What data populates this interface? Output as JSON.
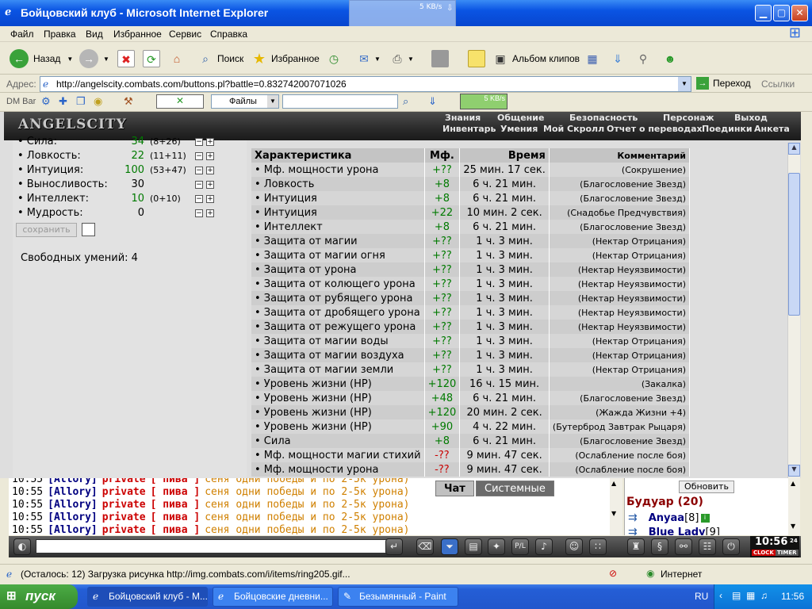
{
  "window": {
    "title": "Бойцовский клуб - Microsoft Internet Explorer"
  },
  "netmon": {
    "speed": "5 KB/s"
  },
  "menu": [
    "Файл",
    "Правка",
    "Вид",
    "Избранное",
    "Сервис",
    "Справка"
  ],
  "toolbar": {
    "back": "Назад",
    "search": "Поиск",
    "favorites": "Избранное",
    "album": "Альбом клипов"
  },
  "address": {
    "label": "Адрес:",
    "url": "http://angelscity.combats.com/buttons.pl?battle=0.832742007071026",
    "go": "Переход",
    "links": "Ссылки"
  },
  "dmbar": {
    "label": "DM Bar",
    "files": "Файлы",
    "speed": "5 KB/s"
  },
  "game": {
    "logo": "ANGELSCITY",
    "nav_top": [
      "Знания",
      "Общение",
      "Безопасность",
      "Персонаж",
      "Выход"
    ],
    "nav_bottom": [
      "Инвентарь",
      "Умения",
      "Мой Скролл",
      "Отчет о переводах",
      "Поединки",
      "Анкета"
    ]
  },
  "stats": [
    {
      "name": "• Сила:",
      "value": "34",
      "extra": "(8+26)"
    },
    {
      "name": "• Ловкость:",
      "value": "22",
      "extra": "(11+11)"
    },
    {
      "name": "• Интуиция:",
      "value": "100",
      "extra": "(53+47)"
    },
    {
      "name": "• Выносливость:",
      "value": "30",
      "extra": ""
    },
    {
      "name": "• Интеллект:",
      "value": "10",
      "extra": "(0+10)"
    },
    {
      "name": "• Мудрость:",
      "value": "0",
      "extra": ""
    }
  ],
  "save_button": "сохранить",
  "free_skills": "Свободных умений: 4",
  "table": {
    "headers": [
      "Характеристика",
      "Мф.",
      "Время",
      "Комментарий"
    ],
    "rows": [
      [
        "• Мф. мощности урона",
        "+??",
        "25 мин. 17 сек.",
        "(Сокрушение)"
      ],
      [
        "• Ловкость",
        "+8",
        "6 ч. 21 мин.",
        "(Благословение Звезд)"
      ],
      [
        "• Интуиция",
        "+8",
        "6 ч. 21 мин.",
        "(Благословение Звезд)"
      ],
      [
        "• Интуиция",
        "+22",
        "10 мин. 2 сек.",
        "(Снадобье Предчувствия)"
      ],
      [
        "• Интеллект",
        "+8",
        "6 ч. 21 мин.",
        "(Благословение Звезд)"
      ],
      [
        "• Защита от магии",
        "+??",
        "1 ч. 3 мин.",
        "(Нектар Отрицания)"
      ],
      [
        "• Защита от магии огня",
        "+??",
        "1 ч. 3 мин.",
        "(Нектар Отрицания)"
      ],
      [
        "• Защита от урона",
        "+??",
        "1 ч. 3 мин.",
        "(Нектар Неуязвимости)"
      ],
      [
        "• Защита от колющего урона",
        "+??",
        "1 ч. 3 мин.",
        "(Нектар Неуязвимости)"
      ],
      [
        "• Защита от рубящего урона",
        "+??",
        "1 ч. 3 мин.",
        "(Нектар Неуязвимости)"
      ],
      [
        "• Защита от дробящего урона",
        "+??",
        "1 ч. 3 мин.",
        "(Нектар Неуязвимости)"
      ],
      [
        "• Защита от режущего урона",
        "+??",
        "1 ч. 3 мин.",
        "(Нектар Неуязвимости)"
      ],
      [
        "• Защита от магии воды",
        "+??",
        "1 ч. 3 мин.",
        "(Нектар Отрицания)"
      ],
      [
        "• Защита от магии воздуха",
        "+??",
        "1 ч. 3 мин.",
        "(Нектар Отрицания)"
      ],
      [
        "• Защита от магии земли",
        "+??",
        "1 ч. 3 мин.",
        "(Нектар Отрицания)"
      ],
      [
        "• Уровень жизни (HP)",
        "+120",
        "16 ч. 15 мин.",
        "(Закалка)"
      ],
      [
        "• Уровень жизни (HP)",
        "+48",
        "6 ч. 21 мин.",
        "(Благословение Звезд)"
      ],
      [
        "• Уровень жизни (HP)",
        "+120",
        "20 мин. 2 сек.",
        "(Жажда Жизни +4)"
      ],
      [
        "• Уровень жизни (HP)",
        "+90",
        "4 ч. 22 мин.",
        "(Бутерброд Завтрак Рыцаря)"
      ],
      [
        "• Сила",
        "+8",
        "6 ч. 21 мин.",
        "(Благословение Звезд)"
      ],
      [
        "• Мф. мощности магии стихий",
        "-??",
        "9 мин. 47 сек.",
        "(Ослабление после боя)"
      ],
      [
        "• Мф. мощности урона",
        "-??",
        "9 мин. 47 сек.",
        "(Ослабление после боя)"
      ]
    ]
  },
  "chat": {
    "lines": [
      {
        "time": "10:55",
        "nick": "[Allory]",
        "private": "private",
        "to": "[ пива ]",
        "text": "сеня одни победы и по 2-5к урона)"
      },
      {
        "time": "10:55",
        "nick": "[Allory]",
        "private": "private",
        "to": "[ пива ]",
        "text": "сеня одни победы и по 2-5к урона)"
      },
      {
        "time": "10:55",
        "nick": "[Allory]",
        "private": "private",
        "to": "[ пива ]",
        "text": "сеня одни победы и по 2-5к урона)"
      },
      {
        "time": "10:55",
        "nick": "[Allory]",
        "private": "private",
        "to": "[ пива ]",
        "text": "сеня одни победы и по 2-5к урона)"
      },
      {
        "time": "10:55",
        "nick": "[Allory]",
        "private": "private",
        "to": "[ пива ]",
        "text": "сеня одни победы и по 2-5к урона)"
      }
    ],
    "tabs": [
      "Чат",
      "Системные сообщения"
    ]
  },
  "room": {
    "refresh": "Обновить",
    "title": "Будуар (20)",
    "users": [
      {
        "name": "Anyaa",
        "level": "[8]"
      },
      {
        "name": "Blue Lady",
        "level": "[9]"
      }
    ]
  },
  "clock": {
    "time": "10:56",
    "suffix": "24",
    "labels": [
      "CLOCK",
      "TIMER"
    ]
  },
  "status": {
    "text": "(Осталось: 12) Загрузка рисунка http://img.combats.com/i/items/ring205.gif...",
    "zone": "Интернет"
  },
  "taskbar": {
    "start": "пуск",
    "tasks": [
      "Бойцовский клуб - M...",
      "Бойцовские дневни...",
      "Безымянный - Paint"
    ],
    "lang": "RU",
    "time": "11:56"
  },
  "colors": {
    "xp_blue": "#0a54e3",
    "green_value": "#007a00",
    "red_value": "#c80000",
    "chat_orange": "#d08000",
    "chat_red": "#cc0000",
    "chat_blue": "#000080"
  }
}
